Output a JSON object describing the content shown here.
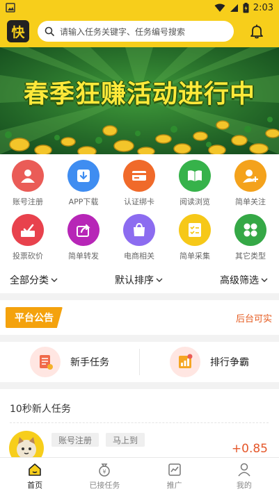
{
  "status_bar": {
    "time": "2:03"
  },
  "header": {
    "logo_text": "快",
    "search_placeholder": "请输入任务关键字、任务编号搜索",
    "accent_color": "#f7ce1b"
  },
  "banner": {
    "title": "春季狂赚活动进行中"
  },
  "categories": [
    {
      "label": "账号注册",
      "icon": "user-icon",
      "color": "#ea5c57"
    },
    {
      "label": "APP下载",
      "icon": "download-icon",
      "color": "#3f8df1"
    },
    {
      "label": "认证绑卡",
      "icon": "card-icon",
      "color": "#f06a2a"
    },
    {
      "label": "阅读浏览",
      "icon": "book-icon",
      "color": "#36b24a"
    },
    {
      "label": "简单关注",
      "icon": "follow-user-icon",
      "color": "#f4a21c"
    },
    {
      "label": "投票砍价",
      "icon": "vote-icon",
      "color": "#e8424d"
    },
    {
      "label": "简单转发",
      "icon": "share-icon",
      "color": "#b726b7"
    },
    {
      "label": "电商相关",
      "icon": "shopping-bag-icon",
      "color": "#8c6cf0"
    },
    {
      "label": "简单采集",
      "icon": "checklist-icon",
      "color": "#f6c818"
    },
    {
      "label": "其它类型",
      "icon": "grid-icon",
      "color": "#35a846"
    }
  ],
  "filters": {
    "all_categories": "全部分类",
    "default_sort": "默认排序",
    "advanced_filter": "高级筛选"
  },
  "notice": {
    "tag": "平台公告",
    "text": "后台可实"
  },
  "quick_entries": [
    {
      "label": "新手任务",
      "icon": "document-icon"
    },
    {
      "label": "排行争霸",
      "icon": "ranking-icon"
    }
  ],
  "tasks": {
    "title": "10秒新人任务",
    "items": [
      {
        "tags": [
          "账号注册",
          "马上到"
        ],
        "reward": "+0.85"
      }
    ]
  },
  "bottom_nav": [
    {
      "label": "首页",
      "icon": "home-icon",
      "active": true
    },
    {
      "label": "已接任务",
      "icon": "money-bag-icon",
      "active": false
    },
    {
      "label": "推广",
      "icon": "chart-icon",
      "active": false
    },
    {
      "label": "我的",
      "icon": "profile-icon",
      "active": false
    }
  ]
}
